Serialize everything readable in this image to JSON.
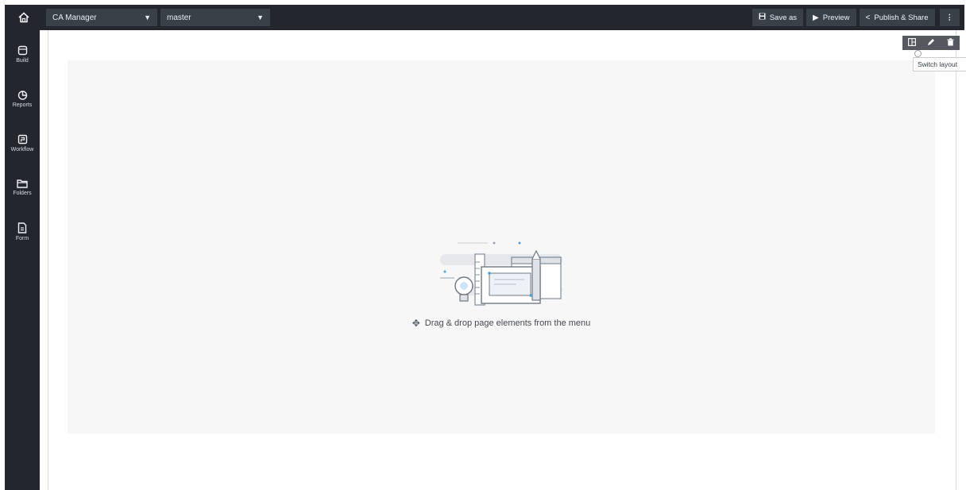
{
  "topbar": {
    "home_icon": "home-icon",
    "app_select": "CA Manager",
    "branch_select": "master",
    "save_as": "Save as",
    "preview": "Preview",
    "publish_share": "Publish & Share",
    "more": "⋮"
  },
  "sidebar": {
    "items": [
      {
        "label": "Build",
        "icon": "build-icon"
      },
      {
        "label": "Reports",
        "icon": "reports-icon"
      },
      {
        "label": "Workflow",
        "icon": "workflow-icon"
      },
      {
        "label": "Folders",
        "icon": "folder-icon"
      },
      {
        "label": "Form",
        "icon": "form-icon"
      }
    ]
  },
  "canvas": {
    "empty_hint": "Drag & drop page elements from the menu"
  },
  "layout_tools": {
    "tooltip": "Switch layout"
  },
  "colors": {
    "chrome": "#23272d",
    "control": "#3a4048",
    "dropzone": "#f7f7f8"
  }
}
